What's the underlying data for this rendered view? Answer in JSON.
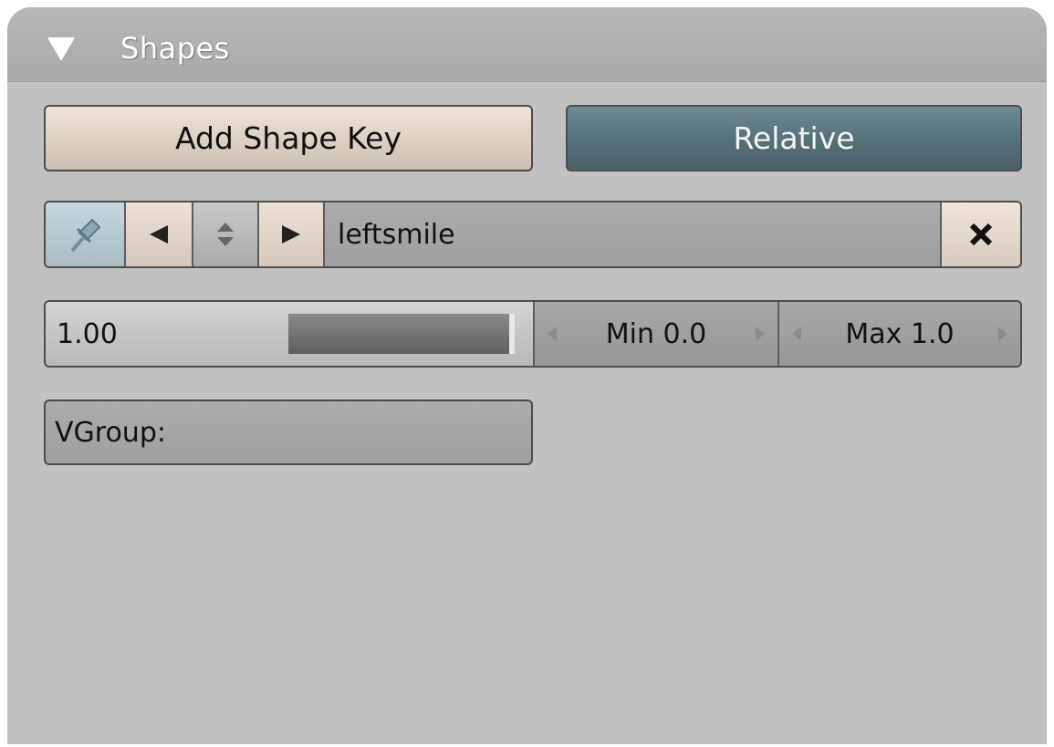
{
  "panel": {
    "title": "Shapes",
    "collapse_icon": "triangle-down-icon"
  },
  "buttons": {
    "add_shape_key": "Add Shape Key",
    "relative": "Relative",
    "relative_active": true
  },
  "shape_key": {
    "name": "leftsmile",
    "pin_icon": "pin-icon",
    "prev_icon": "arrow-left-icon",
    "browse_icon": "up-down-icon",
    "next_icon": "arrow-right-icon",
    "delete_icon": "close-icon"
  },
  "value": {
    "display": "1.00",
    "fraction": 1.0,
    "min_label": "Min 0.0",
    "max_label": "Max 1.0"
  },
  "vgroup": {
    "label": "VGroup:"
  },
  "colors": {
    "panel_bg": "#c1c1c1",
    "relative_active": "#557079",
    "button_tan": "#ddd0c3"
  }
}
